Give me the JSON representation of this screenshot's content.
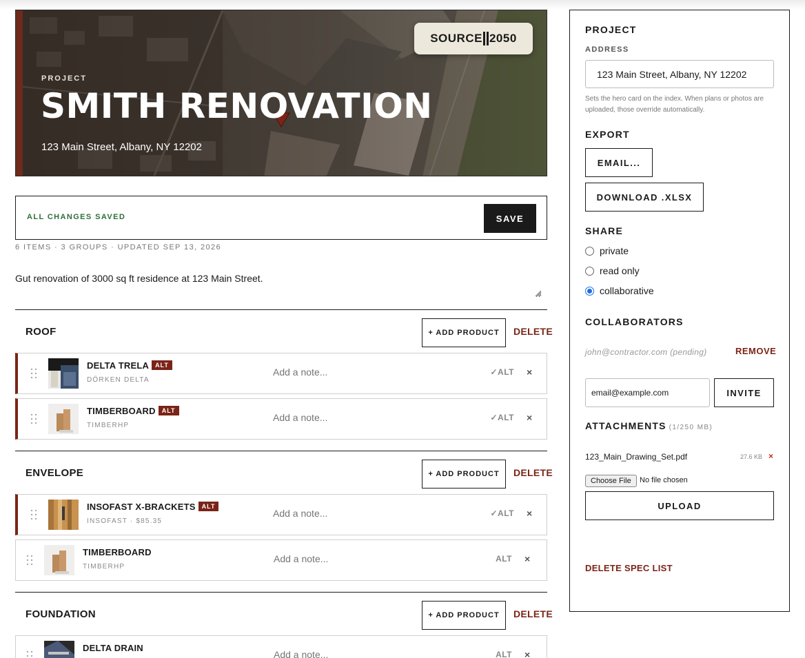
{
  "brand": {
    "left": "SOURCE",
    "right": "2050"
  },
  "hero": {
    "kicker": "PROJECT",
    "title": "SMITH RENOVATION",
    "address": "123 Main Street, Albany, NY 12202"
  },
  "status": {
    "saved_text": "ALL CHANGES SAVED",
    "save_label": "SAVE"
  },
  "meta": "6 ITEMS · 3 GROUPS · UPDATED SEP 13, 2026",
  "description": "Gut renovation of 3000 sq ft residence at 123 Main Street.",
  "labels": {
    "add_product": "+ ADD PRODUCT",
    "delete": "DELETE",
    "note_placeholder": "Add a note...",
    "remove_item": "×",
    "alt_badge": "ALT"
  },
  "groups": [
    {
      "title": "ROOF",
      "items": [
        {
          "name": "DELTA TRELA",
          "manufacturer": "DÖRKEN DELTA",
          "alt_badge": true,
          "alt_toggle": "✓ALT"
        },
        {
          "name": "TIMBERBOARD",
          "manufacturer": "TIMBERHP",
          "alt_badge": true,
          "alt_toggle": "✓ALT"
        }
      ]
    },
    {
      "title": "ENVELOPE",
      "items": [
        {
          "name": "INSOFAST X-BRACKETS",
          "manufacturer": "INSOFAST · $85.35",
          "alt_badge": true,
          "alt_toggle": "✓ALT"
        },
        {
          "name": "TIMBERBOARD",
          "manufacturer": "TIMBERHP",
          "alt_badge": false,
          "alt_toggle": "ALT"
        }
      ]
    },
    {
      "title": "FOUNDATION",
      "items": [
        {
          "name": "DELTA DRAIN",
          "manufacturer": "",
          "alt_badge": false,
          "alt_toggle": "ALT"
        }
      ]
    }
  ],
  "sidebar": {
    "project_heading": "PROJECT",
    "address_label": "ADDRESS",
    "address_value": "123 Main Street, Albany, NY 12202",
    "address_hint": "Sets the hero card on the index. When plans or photos are uploaded, those override automatically.",
    "export_heading": "EXPORT",
    "email_label": "EMAIL...",
    "download_label": "DOWNLOAD .XLSX",
    "share_heading": "SHARE",
    "share_options": [
      "private",
      "read only",
      "collaborative"
    ],
    "share_selected": "collaborative",
    "collaborators_heading": "COLLABORATORS",
    "collaborator": "john@contractor.com (pending)",
    "remove_label": "REMOVE",
    "invite_value": "email@example.com",
    "invite_label": "INVITE",
    "attachments_heading": "ATTACHMENTS",
    "attachments_usage": "(1/250 MB)",
    "file_name": "123_Main_Drawing_Set.pdf",
    "file_size": "27.6 KB",
    "file_remove": "×",
    "choose_file_label": "Choose File",
    "no_file_label": "No file chosen",
    "upload_label": "UPLOAD",
    "delete_spec_label": "DELETE SPEC LIST"
  },
  "colors": {
    "accent": "#7a2418",
    "saved": "#2e6e3a",
    "radio": "#1a6fe8"
  }
}
